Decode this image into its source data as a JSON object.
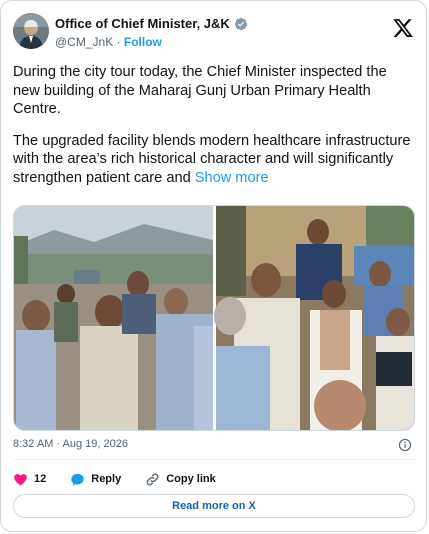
{
  "author": {
    "display_name": "Office of Chief Minister, J&K",
    "handle": "@CM_JnK",
    "separator": "·",
    "follow_label": "Follow"
  },
  "post": {
    "paragraph_1": "During the city tour today, the Chief Minister inspected the new building of the Maharaj Gunj Urban Primary Health Centre.",
    "paragraph_2": "The upgraded facility blends modern healthcare infrastructure with the area’s rich historical character and will significantly strengthen patient care and ",
    "show_more_label": "Show more"
  },
  "meta": {
    "timestamp": "8:32 AM · Aug 19, 2026"
  },
  "actions": {
    "like_count": "12",
    "reply_label": "Reply",
    "copy_link_label": "Copy link"
  },
  "footer": {
    "read_more_label": "Read more on X"
  },
  "colors": {
    "accent": "#1d9bf0",
    "heart": "#f91880",
    "reply": "#1d9bf0",
    "text_secondary": "#536471"
  },
  "icons": [
    "verified-badge-icon",
    "x-logo-icon",
    "info-icon",
    "heart-icon",
    "reply-bubble-icon",
    "link-icon"
  ]
}
